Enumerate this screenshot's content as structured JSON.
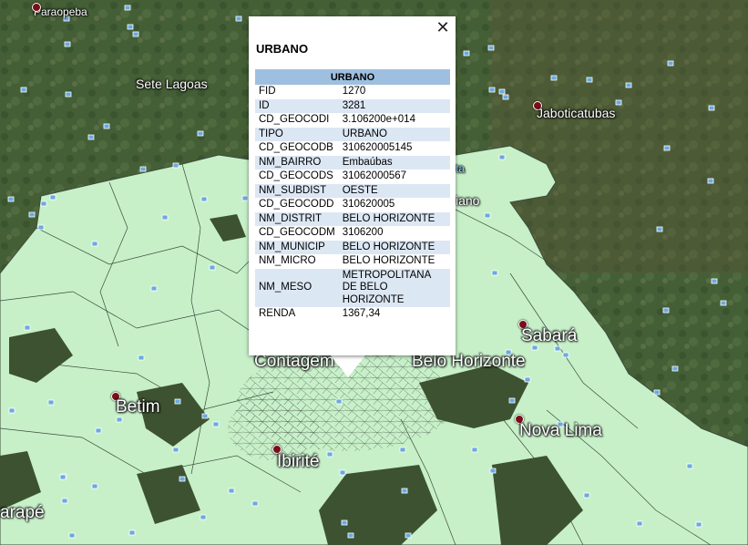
{
  "popup": {
    "title": "URBANO",
    "table_header": "URBANO",
    "close_icon": "close-icon",
    "rows": [
      {
        "key": "FID",
        "value": "1270"
      },
      {
        "key": "ID",
        "value": "3281"
      },
      {
        "key": "CD_GEOCODI",
        "value": "3.106200e+014"
      },
      {
        "key": "TIPO",
        "value": "URBANO"
      },
      {
        "key": "CD_GEOCODB",
        "value": "310620005145"
      },
      {
        "key": "NM_BAIRRO",
        "value": "Embaúbas"
      },
      {
        "key": "CD_GEOCODS",
        "value": "31062000567"
      },
      {
        "key": "NM_SUBDIST",
        "value": "OESTE"
      },
      {
        "key": "CD_GEOCODD",
        "value": "310620005"
      },
      {
        "key": "NM_DISTRIT",
        "value": "BELO HORIZONTE"
      },
      {
        "key": "CD_GEOCODM",
        "value": "3106200"
      },
      {
        "key": "NM_MUNICIP",
        "value": "BELO HORIZONTE"
      },
      {
        "key": "NM_MICRO",
        "value": "BELO HORIZONTE"
      },
      {
        "key": "NM_MESO",
        "value": "METROPOLITANA DE BELO HORIZONTE"
      },
      {
        "key": "RENDA",
        "value": "1367,34"
      }
    ]
  },
  "places": {
    "paraopeba": "Paraopeba",
    "sete_lagoas": "Sete Lagoas",
    "jaboticatubas": "Jaboticatubas",
    "contagem": "Contagem",
    "belo_horizonte": "Belo Horizonte",
    "sabara": "Sabará",
    "betim": "Betim",
    "nova_lima": "Nova Lima",
    "ibirite": "Ibirité",
    "itaparape": "arapé",
    "ta": "ta",
    "iano": "iano"
  },
  "colors": {
    "urban_fill": "#c7f0c9",
    "boundary": "#3c4c3c",
    "forest": "#3f5a33",
    "popup_header": "#9fbfe0",
    "popup_alt_row": "#dce7f4",
    "pin": "#7a0f16"
  }
}
